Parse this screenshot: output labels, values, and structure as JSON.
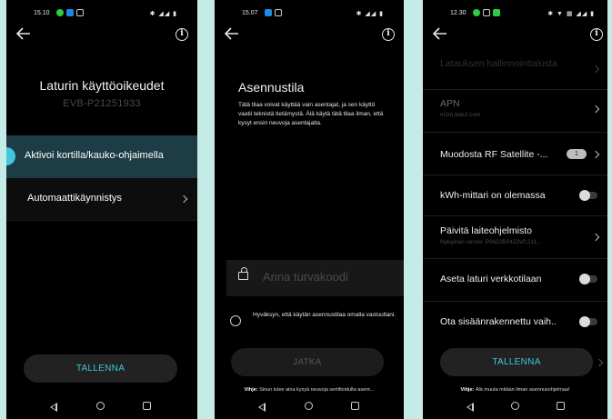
{
  "screen1": {
    "status_time": "15.10",
    "title": "Laturin käyttöoikeudet",
    "subtitle": "EVB-P21251933",
    "options": [
      {
        "label": "Aktivoi kortilla/kauko-ohjaimella"
      },
      {
        "label": "Automaattikäynnistys"
      }
    ],
    "save_label": "TALLENNA"
  },
  "screen2": {
    "status_time": "15.07",
    "title": "Asennustila",
    "description": "Tätä tilaa voivat käyttää vain asentajat, ja sen käyttö vaatii teknistä tietämystä. Älä käytä tätä tilaa ilman, että kysyt ensin neuvoja asentajalta.",
    "code_placeholder": "Anna turvakoodi",
    "accept_text": "Hyväksyn, että käytän asennustilaa omalla vastuullani.",
    "continue_label": "JATKA",
    "hint_prefix": "Vihje:",
    "hint_text": "Sinun tulee aina kysyä neuvoja sertifioidulta asent..."
  },
  "screen3": {
    "status_time": "12.30",
    "rows": [
      {
        "label": "Latauksen hallinnointialusta",
        "sub": ""
      },
      {
        "label": "APN",
        "sub": "m2m.tele2.com"
      },
      {
        "label": "Muodosta RF Satellite -...",
        "badge": "1"
      },
      {
        "label": "kWh-mittari on olemassa"
      },
      {
        "label": "Päivitä laiteohjelmisto",
        "sub": "Nykyinen versio: P0422B0422v0.211..."
      },
      {
        "label": "Aseta laturi verkkotilaan"
      },
      {
        "label": "Ota sisäänrakennettu vaih.."
      }
    ],
    "save_label": "TALLENNA",
    "hint_prefix": "Vihje:",
    "hint_text": "Älä muuta mitään ilman asennusohjelmaa!"
  },
  "colors": {
    "accent": "#3ec6de",
    "selected_row": "#1d3c45",
    "background": "#c5ebe6"
  },
  "icons": [
    "back-arrow-icon",
    "info-icon",
    "chevron-right-icon",
    "lock-icon",
    "toggle-switch",
    "nav-back-icon",
    "nav-home-icon",
    "nav-recents-icon"
  ]
}
